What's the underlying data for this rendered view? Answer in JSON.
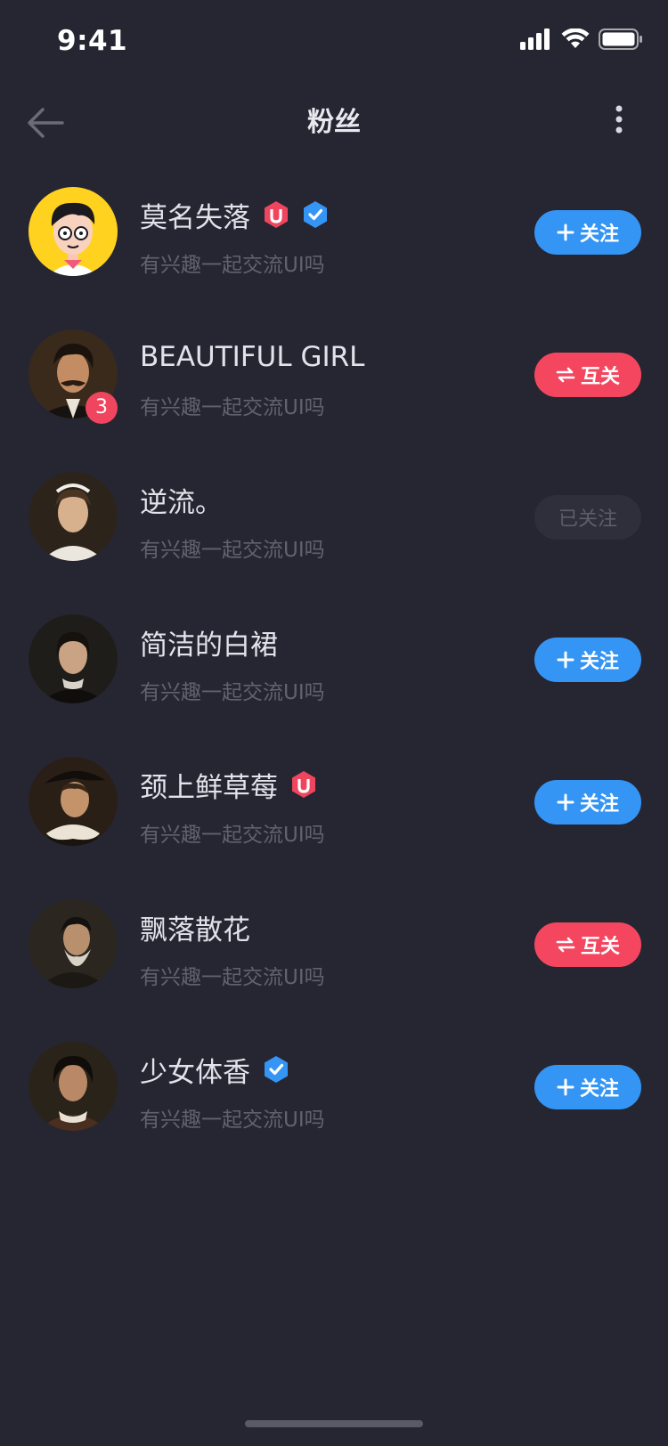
{
  "status_bar": {
    "time": "9:41"
  },
  "nav": {
    "title": "粉丝"
  },
  "badge_colors": {
    "u_badge": "#f0455f",
    "verified": "#3595f5"
  },
  "fans": [
    {
      "name": "莫名失落",
      "subtitle": "有兴趣一起交流UI吗",
      "badges": [
        "u-badge-icon",
        "verified-icon"
      ],
      "action": "follow",
      "action_label": "关注",
      "avatar_badge": ""
    },
    {
      "name": "BEAUTIFUL GIRL",
      "subtitle": "有兴趣一起交流UI吗",
      "badges": [],
      "action": "mutual",
      "action_label": "互关",
      "avatar_badge": "3"
    },
    {
      "name": "逆流。",
      "subtitle": "有兴趣一起交流UI吗",
      "badges": [],
      "action": "following",
      "action_label": "已关注",
      "avatar_badge": ""
    },
    {
      "name": "简洁的白裙",
      "subtitle": "有兴趣一起交流UI吗",
      "badges": [],
      "action": "follow",
      "action_label": "关注",
      "avatar_badge": ""
    },
    {
      "name": "颈上鲜草莓",
      "subtitle": "有兴趣一起交流UI吗",
      "badges": [
        "u-badge-icon"
      ],
      "action": "follow",
      "action_label": "关注",
      "avatar_badge": ""
    },
    {
      "name": "飘落散花",
      "subtitle": "有兴趣一起交流UI吗",
      "badges": [],
      "action": "mutual",
      "action_label": "互关",
      "avatar_badge": ""
    },
    {
      "name": "少女体香",
      "subtitle": "有兴趣一起交流UI吗",
      "badges": [
        "verified-icon"
      ],
      "action": "follow",
      "action_label": "关注",
      "avatar_badge": ""
    }
  ]
}
